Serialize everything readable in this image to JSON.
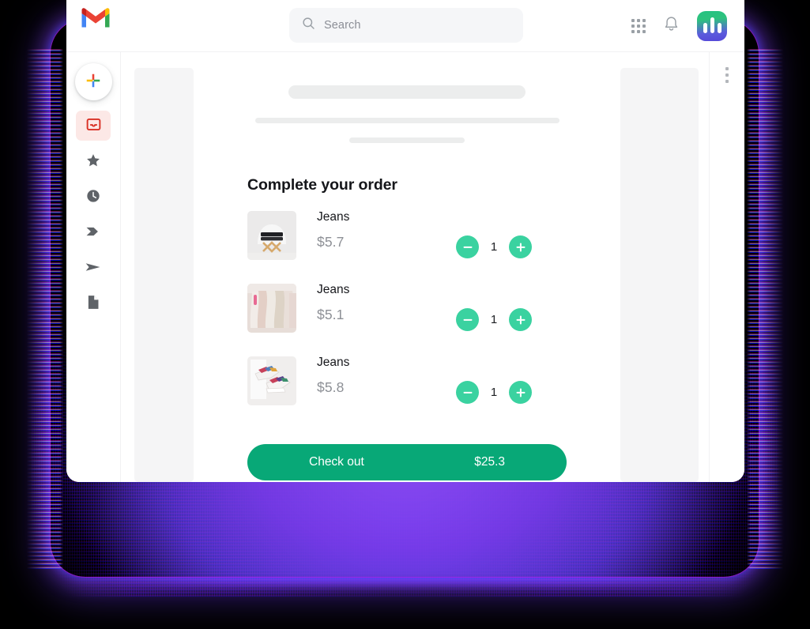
{
  "app": {
    "logo_icon": "gmail-logo-icon",
    "brand_tile_icon": "brand-app-icon",
    "brand_gradient_start": "#2ec27e",
    "brand_gradient_end": "#5548d8"
  },
  "header": {
    "search": {
      "placeholder": "Search",
      "value": "Search",
      "icon": "search-icon"
    },
    "apps_icon": "apps-grid-icon",
    "notifications_icon": "bell-icon"
  },
  "sidebar": {
    "compose": {
      "label": "Compose",
      "icon": "plus-icon"
    },
    "items": [
      {
        "label": "Inbox",
        "icon": "inbox-icon",
        "active": true
      },
      {
        "label": "Starred",
        "icon": "star-icon",
        "active": false
      },
      {
        "label": "Snoozed",
        "icon": "clock-icon",
        "active": false
      },
      {
        "label": "Important",
        "icon": "label-icon",
        "active": false
      },
      {
        "label": "Sent",
        "icon": "send-icon",
        "active": false
      },
      {
        "label": "Drafts",
        "icon": "document-icon",
        "active": false
      }
    ]
  },
  "message": {
    "skeleton_lines": 3,
    "order": {
      "title": "Complete your order",
      "items": [
        {
          "name": "Jeans",
          "price": "$5.7",
          "qty": "1",
          "thumb": "folded-black-jeans-on-chair",
          "decrease_label": "Decrease quantity",
          "increase_label": "Increase quantity"
        },
        {
          "name": "Jeans",
          "price": "$5.1",
          "qty": "1",
          "thumb": "clothes-on-hanger-rack",
          "decrease_label": "Decrease quantity",
          "increase_label": "Increase quantity"
        },
        {
          "name": "Jeans",
          "price": "$5.8",
          "qty": "1",
          "thumb": "colorful-sneakers-pair",
          "decrease_label": "Decrease quantity",
          "increase_label": "Increase quantity"
        }
      ],
      "checkout_label": "Check out",
      "checkout_total": "$25.3",
      "checkout_color": "#08a877",
      "stepper_color": "#3ad2a0"
    }
  },
  "rail": {
    "menu_icon": "kebab-menu-icon"
  }
}
